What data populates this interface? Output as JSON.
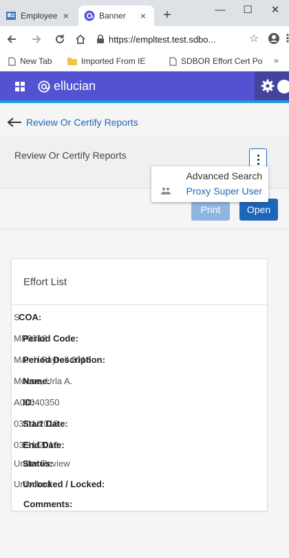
{
  "browser": {
    "tabs": [
      {
        "title": "Employee"
      },
      {
        "title": "Banner"
      }
    ],
    "url": "https://empltest.test.sdbo...",
    "bookmarks": [
      {
        "label": "New Tab"
      },
      {
        "label": "Imported From IE"
      },
      {
        "label": "SDBOR Effort Cert Po"
      }
    ]
  },
  "app": {
    "brand": "ellucian"
  },
  "nav": {
    "back_label": "Review Or Certify Reports"
  },
  "page": {
    "title": "Review Or Certify Reports"
  },
  "menu": {
    "items": [
      {
        "label": "Advanced Search"
      },
      {
        "label": "Proxy Super User"
      }
    ]
  },
  "actions": {
    "print": "Print",
    "open": "Open"
  },
  "effort_list": {
    "title": "Effort List",
    "fields": [
      {
        "label": "COA:",
        "value": "S"
      },
      {
        "label": "Period Code:",
        "value": "MP0318"
      },
      {
        "label": "Period Description:",
        "value": "March Payroll 2018"
      },
      {
        "label": "Name:",
        "value": "Moose, Urla A."
      },
      {
        "label": "ID:",
        "value": "A00040350"
      },
      {
        "label": "Start Date:",
        "value": "03/01/2018"
      },
      {
        "label": "End Date:",
        "value": "03/31/2018"
      },
      {
        "label": "Status:",
        "value": "Under Review"
      },
      {
        "label": "Unlocked / Locked:",
        "value": "Unlocked"
      },
      {
        "label": "Comments:",
        "value": ""
      }
    ]
  }
}
